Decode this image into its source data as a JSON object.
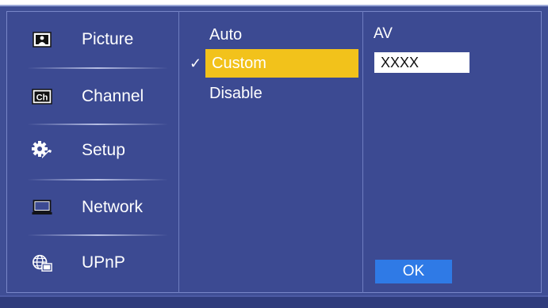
{
  "sidebar": {
    "items": [
      {
        "label": "Picture",
        "icon": "picture-icon"
      },
      {
        "label": "Channel",
        "icon": "channel-icon",
        "icon_text": "Ch"
      },
      {
        "label": "Setup",
        "icon": "gear-wrench-icon"
      },
      {
        "label": "Network",
        "icon": "laptop-icon"
      },
      {
        "label": "UPnP",
        "icon": "globe-network-icon"
      }
    ]
  },
  "options": {
    "items": [
      "Auto",
      "Custom",
      "Disable"
    ],
    "selected": "Custom",
    "checkmark": "✓",
    "highlight_color": "#f2c21b"
  },
  "right_panel": {
    "label": "AV",
    "input_value": "XXXX",
    "ok_label": "OK",
    "ok_color": "#2f7ae6"
  },
  "colors": {
    "background": "#3f4e95",
    "text": "#ffffff"
  }
}
